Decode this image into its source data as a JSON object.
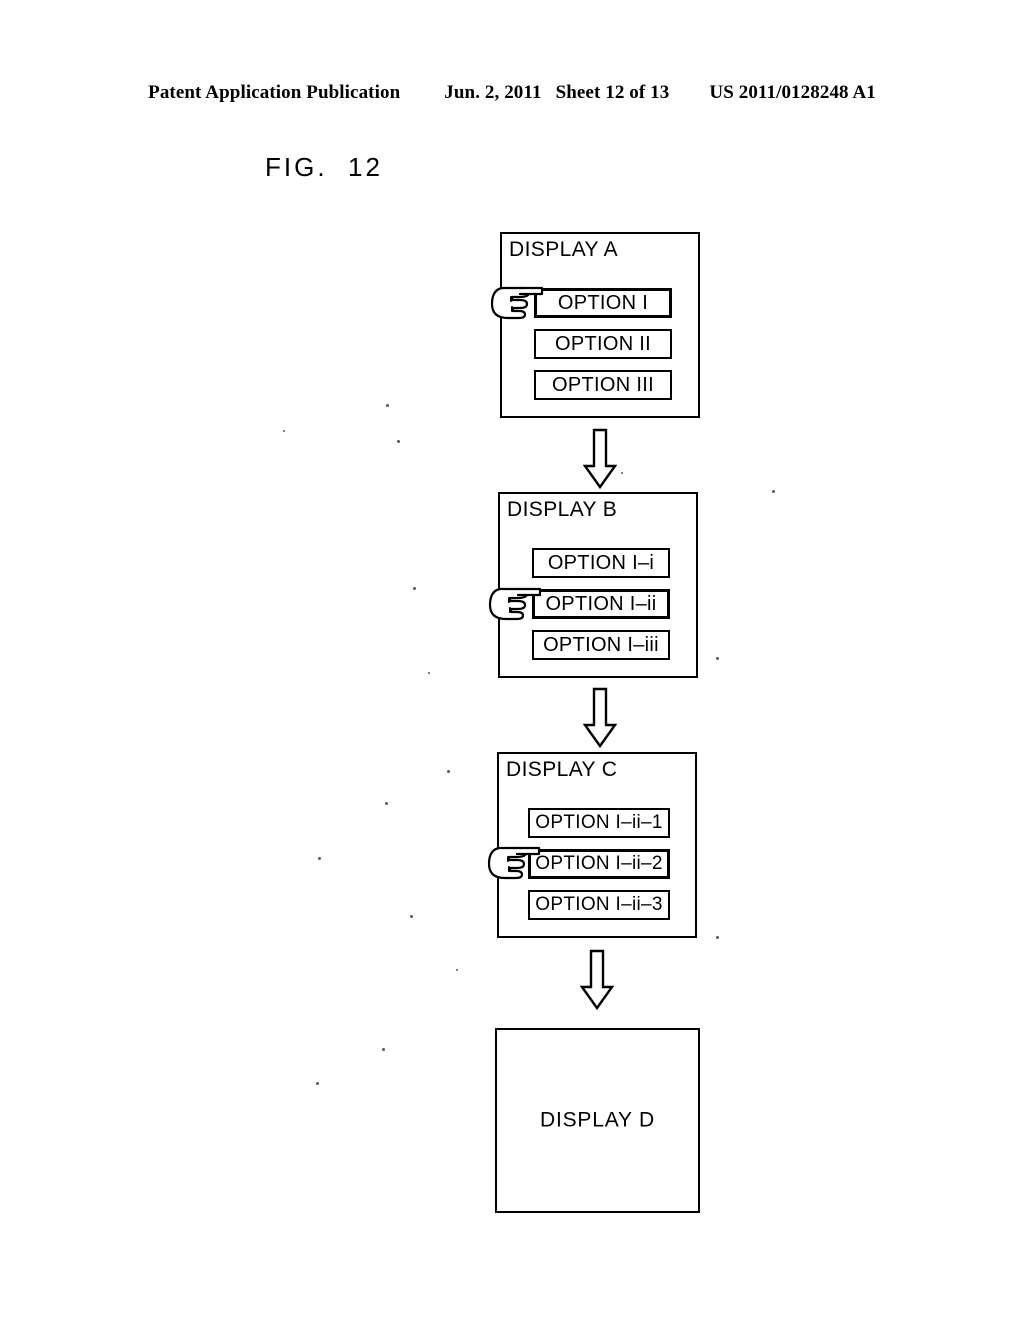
{
  "header": {
    "publication": "Patent Application Publication",
    "date": "Jun. 2, 2011",
    "sheet": "Sheet 12 of 13",
    "number": "US 2011/0128248 A1"
  },
  "figure": {
    "label": "FIG.  12"
  },
  "displays": [
    {
      "id": "display-a",
      "title": "DISPLAY A",
      "options": [
        {
          "label": "OPTION I",
          "selected": true
        },
        {
          "label": "OPTION II",
          "selected": false
        },
        {
          "label": "OPTION III",
          "selected": false
        }
      ],
      "cursor": {
        "icon": "pointing-hand-icon",
        "points_at": "OPTION I"
      }
    },
    {
      "id": "display-b",
      "title": "DISPLAY B",
      "options": [
        {
          "label": "OPTION I–i",
          "selected": false
        },
        {
          "label": "OPTION I–ii",
          "selected": true
        },
        {
          "label": "OPTION I–iii",
          "selected": false
        }
      ],
      "cursor": {
        "icon": "pointing-hand-icon",
        "points_at": "OPTION I–ii"
      }
    },
    {
      "id": "display-c",
      "title": "DISPLAY C",
      "options": [
        {
          "label": "OPTION I–ii–1",
          "selected": false
        },
        {
          "label": "OPTION I–ii–2",
          "selected": true
        },
        {
          "label": "OPTION I–ii–3",
          "selected": false
        }
      ],
      "cursor": {
        "icon": "pointing-hand-icon",
        "points_at": "OPTION I–ii–2"
      }
    },
    {
      "id": "display-d",
      "title": "DISPLAY D",
      "options": [],
      "cursor": null
    }
  ],
  "arrows": [
    {
      "id": "arrow-a-to-b",
      "icon": "down-block-arrow-icon"
    },
    {
      "id": "arrow-b-to-c",
      "icon": "down-block-arrow-icon"
    },
    {
      "id": "arrow-c-to-d",
      "icon": "down-block-arrow-icon"
    }
  ],
  "colors": {
    "ink": "#000000",
    "paper": "#ffffff"
  }
}
